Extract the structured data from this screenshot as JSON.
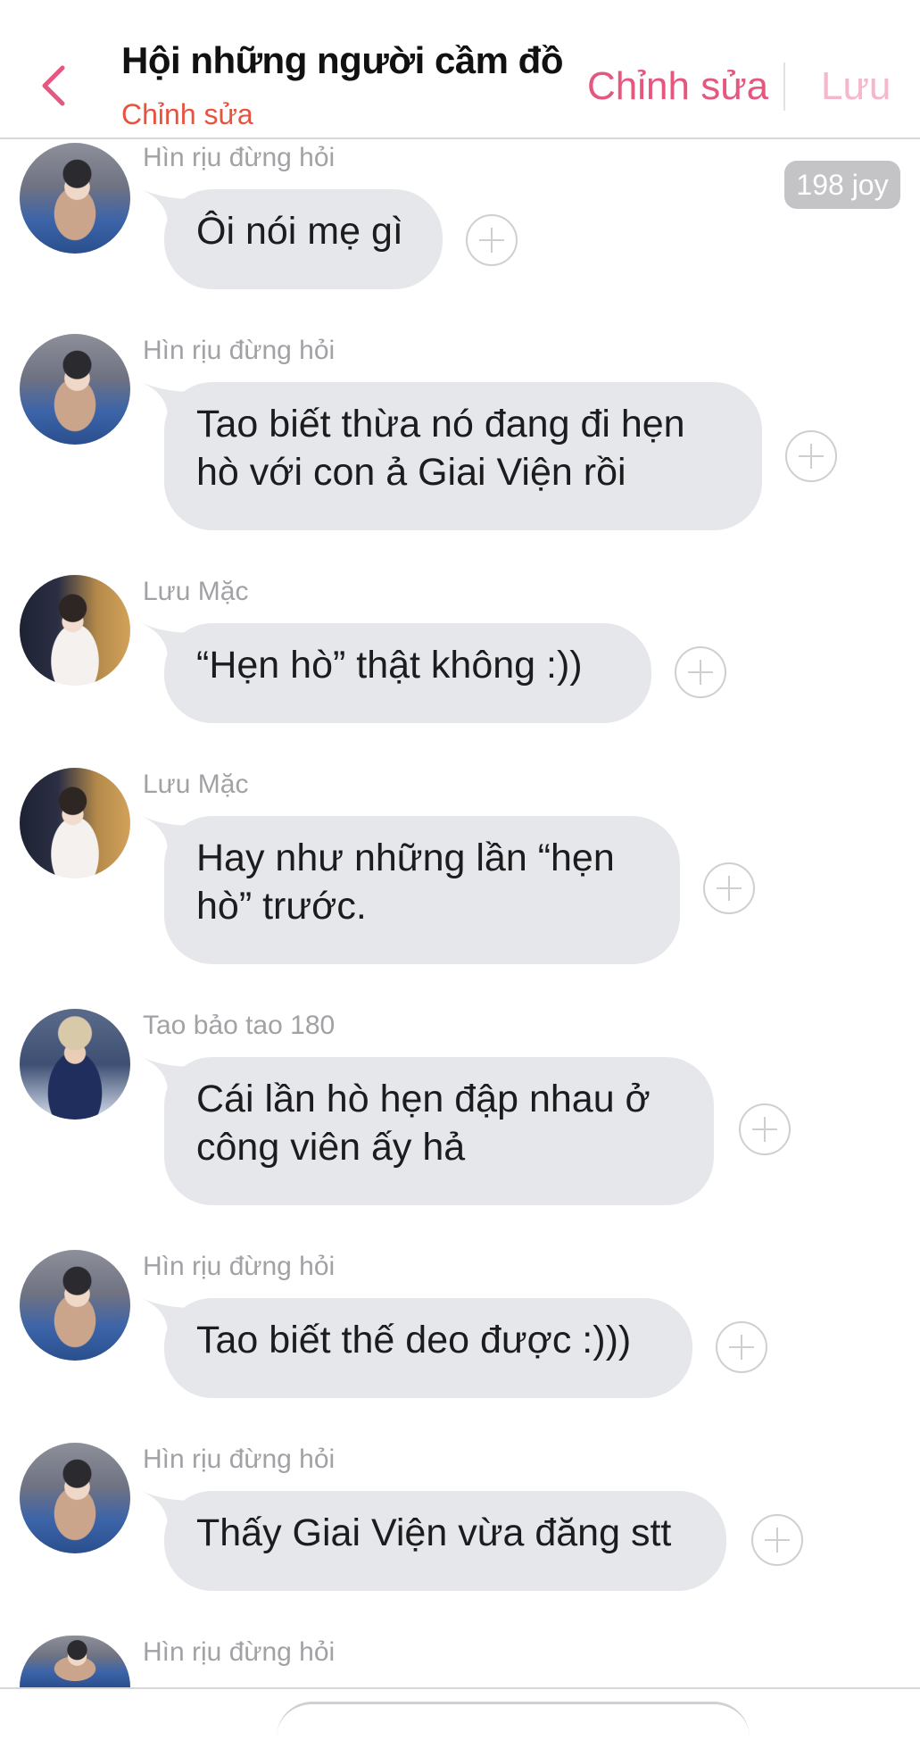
{
  "header": {
    "title": "Hội những người cầm đồ",
    "subtitle": "Chỉnh sửa",
    "edit_label": "Chỉnh sửa",
    "save_label": "Lưu",
    "back_icon": "chevron-left-icon",
    "accent_color": "#e4577f"
  },
  "joy_badge": "198 joy",
  "messages": [
    {
      "sender": "Hìn rịu đừng hỏi",
      "lines": [
        "Ôi nói mẹ gì"
      ]
    },
    {
      "sender": "Hìn rịu đừng hỏi",
      "lines": [
        "Tao biết thừa nó đang đi hẹn",
        "hò với con ả Giai Viện rồi"
      ]
    },
    {
      "sender": "Lưu Mặc",
      "lines": [
        "“Hẹn hò” thật không :))"
      ]
    },
    {
      "sender": "Lưu Mặc",
      "lines": [
        "Hay như những lần “hẹn",
        "hò” trước."
      ]
    },
    {
      "sender": "Tao bảo tao 180",
      "lines": [
        "Cái lần hò hẹn đập nhau ở",
        "công viên ấy hả"
      ]
    },
    {
      "sender": "Hìn rịu đừng hỏi",
      "lines": [
        "Tao biết thế deo được :)))"
      ]
    },
    {
      "sender": "Hìn rịu đừng hỏi",
      "lines": [
        "Thấy Giai Viện vừa đăng stt"
      ]
    },
    {
      "sender": "Hìn rịu đừng hỏi",
      "lines": []
    }
  ],
  "bubble_color": "#e6e7ea",
  "plus_icon": "plus-circle-icon"
}
